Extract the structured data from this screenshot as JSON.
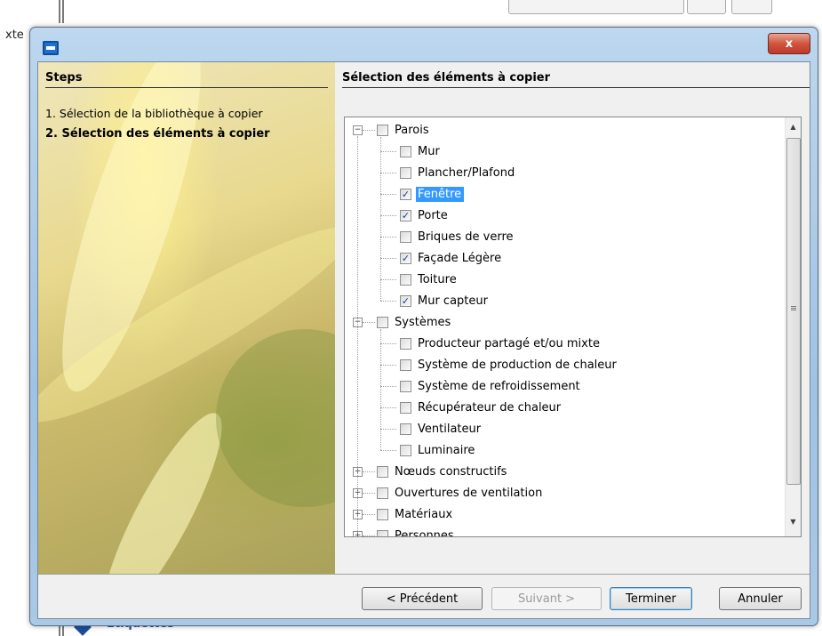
{
  "background": {
    "partial_text": "xte"
  },
  "window": {
    "title": "",
    "close_symbol": "x"
  },
  "steps": {
    "title": "Steps",
    "items": [
      {
        "label": "1. Sélection de la bibliothèque à copier",
        "current": false
      },
      {
        "label": "2. Sélection des éléments à copier",
        "current": true
      }
    ]
  },
  "content": {
    "title": "Sélection des éléments à copier"
  },
  "tree": {
    "nodes": [
      {
        "label": "Parois",
        "level": 0,
        "expanded": true,
        "checked": false
      },
      {
        "label": "Mur",
        "level": 1,
        "checked": false
      },
      {
        "label": "Plancher/Plafond",
        "level": 1,
        "checked": false
      },
      {
        "label": "Fenêtre",
        "level": 1,
        "checked": true,
        "selected": true
      },
      {
        "label": "Porte",
        "level": 1,
        "checked": true
      },
      {
        "label": "Briques de verre",
        "level": 1,
        "checked": false
      },
      {
        "label": "Façade Légère",
        "level": 1,
        "checked": true
      },
      {
        "label": "Toiture",
        "level": 1,
        "checked": false
      },
      {
        "label": "Mur capteur",
        "level": 1,
        "checked": true
      },
      {
        "label": "Systèmes",
        "level": 0,
        "expanded": true,
        "checked": false
      },
      {
        "label": "Producteur partagé et/ou mixte",
        "level": 1,
        "checked": false
      },
      {
        "label": "Système de production de chaleur",
        "level": 1,
        "checked": false
      },
      {
        "label": "Système de refroidissement",
        "level": 1,
        "checked": false
      },
      {
        "label": "Récupérateur de chaleur",
        "level": 1,
        "checked": false
      },
      {
        "label": "Ventilateur",
        "level": 1,
        "checked": false
      },
      {
        "label": "Luminaire",
        "level": 1,
        "checked": false
      },
      {
        "label": "Nœuds constructifs",
        "level": 0,
        "expanded": false,
        "checked": false
      },
      {
        "label": "Ouvertures de ventilation",
        "level": 0,
        "expanded": false,
        "checked": false
      },
      {
        "label": "Matériaux",
        "level": 0,
        "expanded": false,
        "checked": false
      },
      {
        "label": "Personnes",
        "level": 0,
        "expanded": false,
        "checked": false
      }
    ]
  },
  "buttons": {
    "previous": "< Précédent",
    "next": "Suivant >",
    "finish": "Terminer",
    "cancel": "Annuler"
  },
  "colors": {
    "selection": "#3399ff",
    "close_button": "#c1382a",
    "window_frame": "#9ec3e4"
  }
}
